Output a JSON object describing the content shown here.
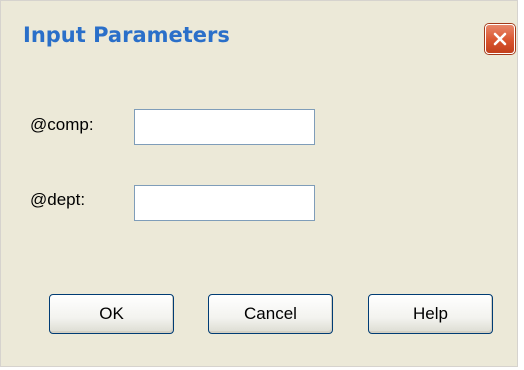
{
  "dialog": {
    "title": "Input Parameters",
    "close_icon": "close-icon",
    "accent_color": "#2a6fc9",
    "close_color": "#d9552f"
  },
  "form": {
    "params": [
      {
        "label": "@comp:",
        "value": ""
      },
      {
        "label": "@dept:",
        "value": ""
      }
    ]
  },
  "buttons": {
    "ok": "OK",
    "cancel": "Cancel",
    "help": "Help"
  }
}
